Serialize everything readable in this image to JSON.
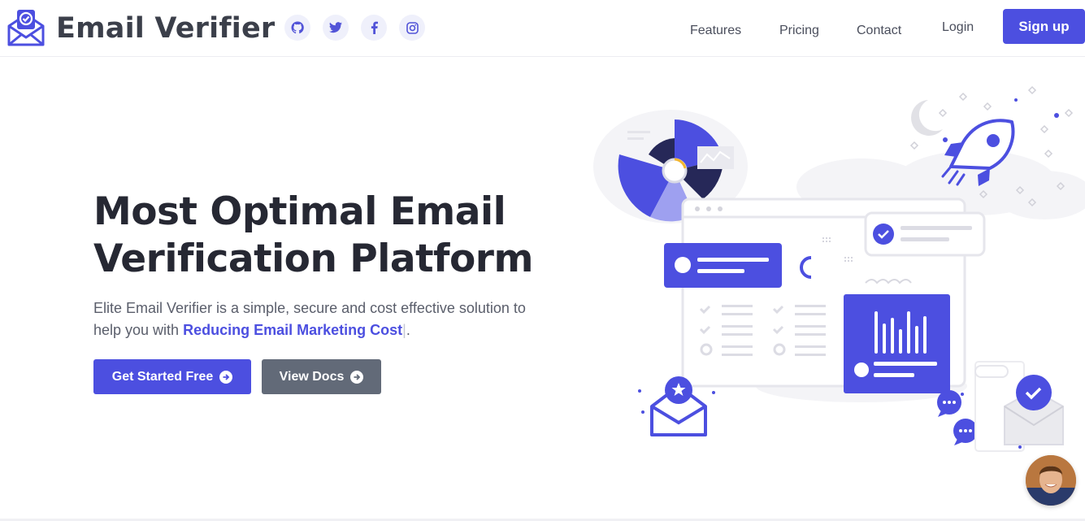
{
  "brand": {
    "name": "Email Verifier",
    "accent": "#4c4fe0",
    "text_dark": "#262833"
  },
  "header": {
    "social_icons": [
      "github-icon",
      "twitter-icon",
      "facebook-icon",
      "instagram-icon"
    ],
    "nav": {
      "features": "Features",
      "pricing": "Pricing",
      "contact": "Contact",
      "login": "Login",
      "signup": "Sign up"
    }
  },
  "hero": {
    "title_line1": "Most Optimal Email",
    "title_line2": "Verification Platform",
    "desc_part1": "Elite Email Verifier is a simple, secure and cost effective solution to help you with ",
    "desc_highlight": "Reducing Email Marketing Cost",
    "desc_caret": "|",
    "desc_end": ".",
    "cta_primary": "Get Started Free",
    "cta_secondary": "View Docs"
  }
}
